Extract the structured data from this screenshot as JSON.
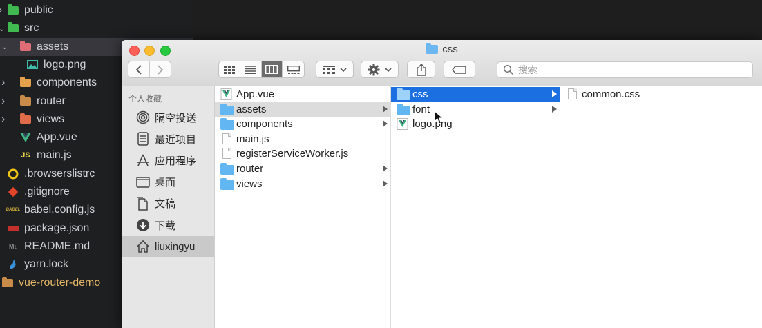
{
  "editor": {
    "tree": [
      {
        "label": "public",
        "icon": "folder-public-icon",
        "depth": 0,
        "chevron": "right",
        "color": "#3fb950"
      },
      {
        "label": "src",
        "icon": "folder-src-icon",
        "depth": 0,
        "chevron": "down",
        "color": "#3fb950"
      },
      {
        "label": "assets",
        "icon": "folder-assets-icon",
        "depth": 1,
        "chevron": "down",
        "color": "#e06c75",
        "selected": true
      },
      {
        "label": "logo.png",
        "icon": "image-file-icon",
        "depth": 2,
        "color": "#3fb9a8"
      },
      {
        "label": "components",
        "icon": "folder-components-icon",
        "depth": 1,
        "chevron": "right",
        "color": "#e5a04b"
      },
      {
        "label": "router",
        "icon": "folder-icon",
        "depth": 1,
        "chevron": "right",
        "color": "#c98b4a"
      },
      {
        "label": "views",
        "icon": "folder-views-icon",
        "depth": 1,
        "chevron": "right",
        "color": "#e06c4a"
      },
      {
        "label": "App.vue",
        "icon": "vue-file-icon",
        "depth": 1,
        "color": "#41b883"
      },
      {
        "label": "main.js",
        "icon": "js-file-icon",
        "depth": 1,
        "color": "#e8d44d"
      },
      {
        "label": ".browserslistrc",
        "icon": "browserslist-icon",
        "depth": 0,
        "color": "#f0c419"
      },
      {
        "label": ".gitignore",
        "icon": "git-icon",
        "depth": 0,
        "color": "#e24329"
      },
      {
        "label": "babel.config.js",
        "icon": "babel-icon",
        "depth": 0,
        "color": "#c8a83c"
      },
      {
        "label": "package.json",
        "icon": "npm-icon",
        "depth": 0,
        "color": "#c4302b"
      },
      {
        "label": "README.md",
        "icon": "markdown-icon",
        "depth": 0,
        "color": "#8a8a8a"
      },
      {
        "label": "yarn.lock",
        "icon": "yarn-icon",
        "depth": 0,
        "color": "#3a8fd6"
      },
      {
        "label": "vue-router-demo",
        "icon": "folder-root-icon",
        "depth": -1,
        "color": "#c98b4a"
      }
    ]
  },
  "finder": {
    "title": "css",
    "search_placeholder": "搜索",
    "sidebar": {
      "heading": "个人收藏",
      "items": [
        {
          "label": "隔空投送",
          "icon": "airdrop-icon"
        },
        {
          "label": "最近项目",
          "icon": "recents-icon"
        },
        {
          "label": "应用程序",
          "icon": "applications-icon"
        },
        {
          "label": "桌面",
          "icon": "desktop-icon"
        },
        {
          "label": "文稿",
          "icon": "documents-icon"
        },
        {
          "label": "下载",
          "icon": "downloads-icon"
        },
        {
          "label": "liuxingyu",
          "icon": "home-icon",
          "selected": true
        }
      ]
    },
    "columns": [
      [
        {
          "label": "App.vue",
          "type": "vue"
        },
        {
          "label": "assets",
          "type": "folder",
          "state": "inactive"
        },
        {
          "label": "components",
          "type": "folder"
        },
        {
          "label": "main.js",
          "type": "file"
        },
        {
          "label": "registerServiceWorker.js",
          "type": "file"
        },
        {
          "label": "router",
          "type": "folder"
        },
        {
          "label": "views",
          "type": "folder"
        }
      ],
      [
        {
          "label": "css",
          "type": "folder",
          "state": "active"
        },
        {
          "label": "font",
          "type": "folder"
        },
        {
          "label": "logo.png",
          "type": "vue"
        }
      ],
      [
        {
          "label": "common.css",
          "type": "file"
        }
      ]
    ]
  }
}
